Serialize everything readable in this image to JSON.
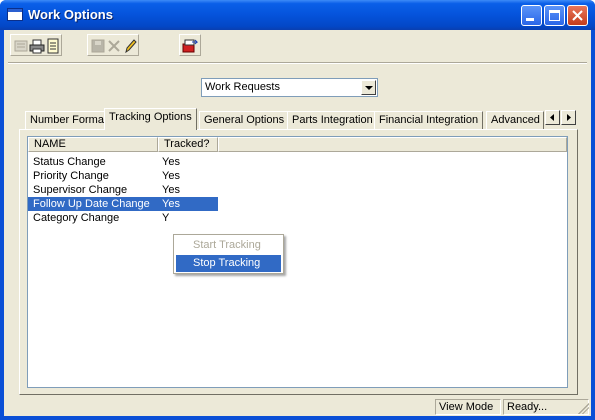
{
  "window": {
    "title": "Work Options"
  },
  "toolbar": {
    "icons": [
      "list-icon",
      "print-icon",
      "report-icon",
      "save-icon",
      "delete-icon",
      "edit-icon",
      "exit-icon"
    ]
  },
  "module_select": {
    "value": "Work Requests"
  },
  "tabs": [
    {
      "label": "Number Format"
    },
    {
      "label": "Tracking Options"
    },
    {
      "label": "General Options"
    },
    {
      "label": "Parts Integration"
    },
    {
      "label": "Financial Integration"
    },
    {
      "label": "Advanced ("
    }
  ],
  "list": {
    "columns": [
      "NAME",
      "Tracked?"
    ],
    "rows": [
      {
        "name": "Status Change",
        "tracked": "Yes"
      },
      {
        "name": "Priority Change",
        "tracked": "Yes"
      },
      {
        "name": "Supervisor Change",
        "tracked": "Yes"
      },
      {
        "name": "Follow Up Date Change",
        "tracked": "Yes"
      },
      {
        "name": "Category Change",
        "tracked": "Y"
      }
    ]
  },
  "context_menu": {
    "items": [
      {
        "label": "Start Tracking",
        "enabled": false
      },
      {
        "label": "Stop Tracking",
        "enabled": true
      }
    ]
  },
  "statusbar": {
    "mode": "View Mode",
    "state": "Ready..."
  },
  "colors": {
    "titlebar": "#0553db",
    "selection": "#316ac5",
    "face": "#ece9d8"
  }
}
